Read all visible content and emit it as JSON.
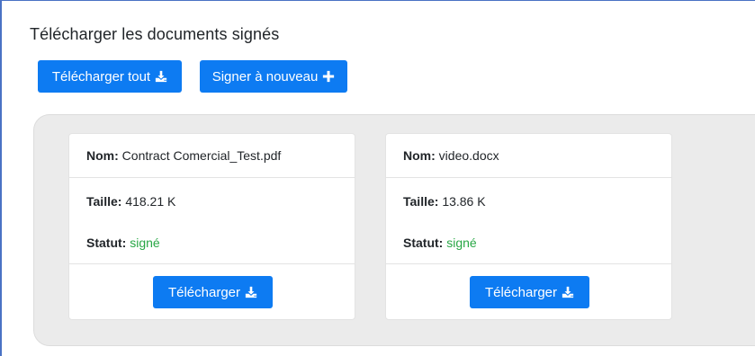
{
  "page": {
    "title": "Télécharger les documents signés"
  },
  "toolbar": {
    "download_all_label": "Télécharger tout",
    "sign_again_label": "Signer à nouveau"
  },
  "labels": {
    "name": "Nom:",
    "size": "Taille:",
    "status": "Statut:"
  },
  "documents": [
    {
      "name": "Contract Comercial_Test.pdf",
      "size": "418.21 K",
      "status": "signé",
      "download_label": "Télécharger"
    },
    {
      "name": "video.docx",
      "size": "13.86 K",
      "status": "signé",
      "download_label": "Télécharger"
    }
  ],
  "colors": {
    "primary": "#0d7bf2",
    "status_signed": "#28a745",
    "panel_bg": "#ebebeb"
  },
  "icons": {
    "download": "download-icon",
    "plus": "plus-icon"
  }
}
